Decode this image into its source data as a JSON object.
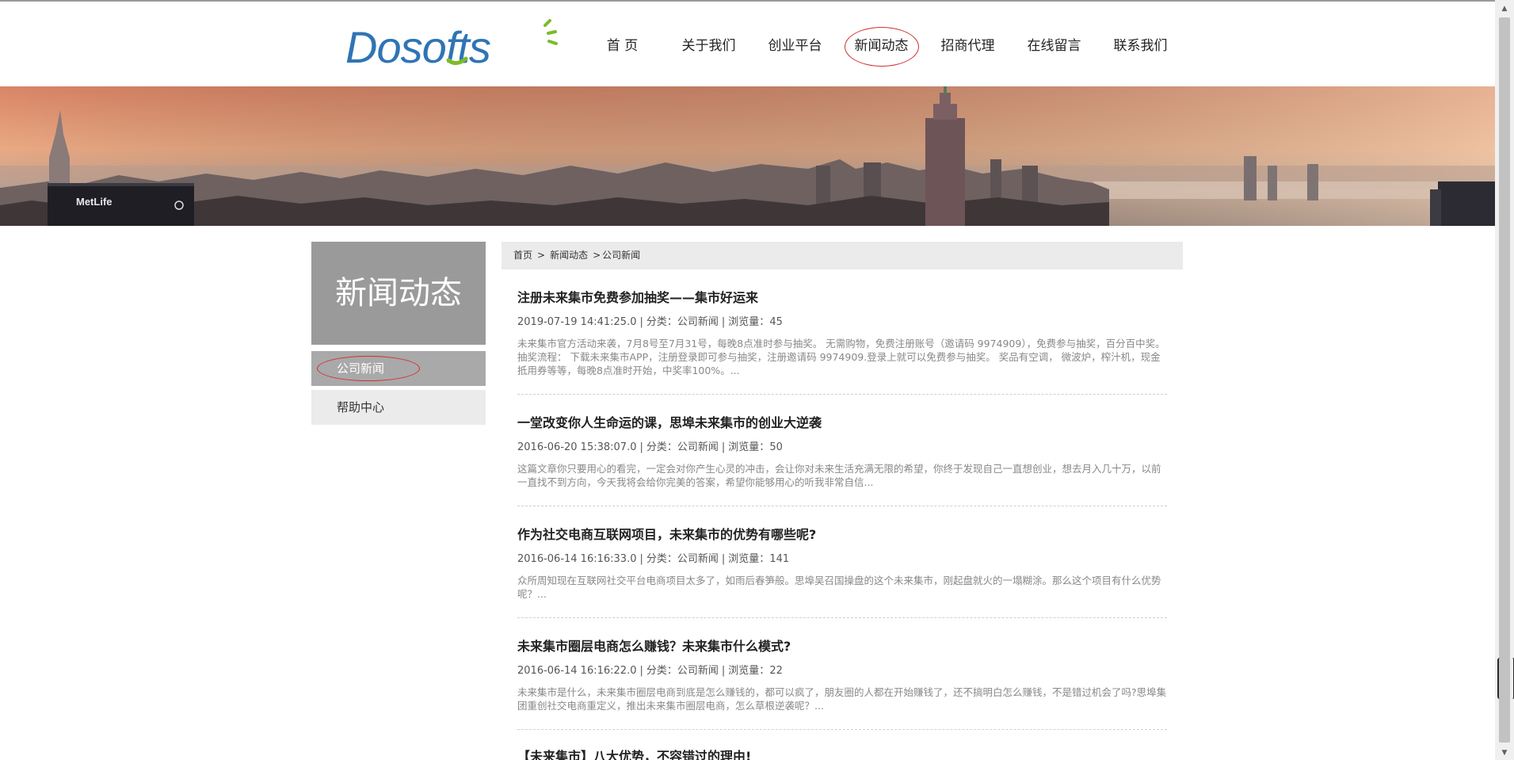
{
  "logo": {
    "text": "Dosofts"
  },
  "nav": {
    "items": [
      {
        "label": "首 页"
      },
      {
        "label": "关于我们"
      },
      {
        "label": "创业平台"
      },
      {
        "label": "新闻动态"
      },
      {
        "label": "招商代理"
      },
      {
        "label": "在线留言"
      },
      {
        "label": "联系我们"
      }
    ],
    "active_index": 3
  },
  "banner": {
    "sign_text": "MetLife"
  },
  "sidebar": {
    "title": "新闻动态",
    "items": [
      {
        "label": "公司新闻"
      },
      {
        "label": "帮助中心"
      }
    ]
  },
  "breadcrumb": {
    "home": "首页",
    "sep1": ">",
    "section": "新闻动态",
    "sep2": ">",
    "current": "公司新闻"
  },
  "meta_labels": {
    "category_label": "分类：",
    "views_label": "浏览量："
  },
  "articles": [
    {
      "title": "注册未来集市免费参加抽奖——集市好运来",
      "date": "2019-07-19 14:41:25.0",
      "category": "公司新闻",
      "views": "45",
      "excerpt": "未来集市官方活动来袭，7月8号至7月31号，每晚8点准时参与抽奖。 无需购物，免费注册账号（邀请码 9974909），免费参与抽奖，百分百中奖。 抽奖流程： 下载未来集市APP，注册登录即可参与抽奖，注册邀请码 9974909.登录上就可以免费参与抽奖。 奖品有空调， 微波炉，榨汁机，现金抵用券等等，每晚8点准时开始，中奖率100%。..."
    },
    {
      "title": "一堂改变你人生命运的课，思埠未来集市的创业大逆袭",
      "date": "2016-06-20 15:38:07.0",
      "category": "公司新闻",
      "views": "50",
      "excerpt": "这篇文章你只要用心的看完，一定会对你产生心灵的冲击，会让你对未来生活充满无限的希望，你终于发现自己一直想创业，想去月入几十万，以前一直找不到方向，今天我将会给你完美的答案，希望你能够用心的听我非常自信..."
    },
    {
      "title": "作为社交电商互联网项目，未来集市的优势有哪些呢?",
      "date": "2016-06-14 16:16:33.0",
      "category": "公司新闻",
      "views": "141",
      "excerpt": "众所周知现在互联网社交平台电商项目太多了，如雨后春笋般。思埠吴召国操盘的这个未来集市，刚起盘就火的一塌糊涂。那么这个项目有什么优势呢？..."
    },
    {
      "title": "未来集市圈层电商怎么赚钱？未来集市什么模式?",
      "date": "2016-06-14 16:16:22.0",
      "category": "公司新闻",
      "views": "22",
      "excerpt": "未来集市是什么，未来集市圈层电商到底是怎么赚钱的，都可以疯了，朋友圈的人都在开始赚钱了，还不搞明白怎么赚钱，不是错过机会了吗?思埠集团重创社交电商重定义，推出未来集市圈层电商，怎么草根逆袭呢？..."
    },
    {
      "title": "【未来集市】八大优势，不容错过的理由!"
    }
  ]
}
